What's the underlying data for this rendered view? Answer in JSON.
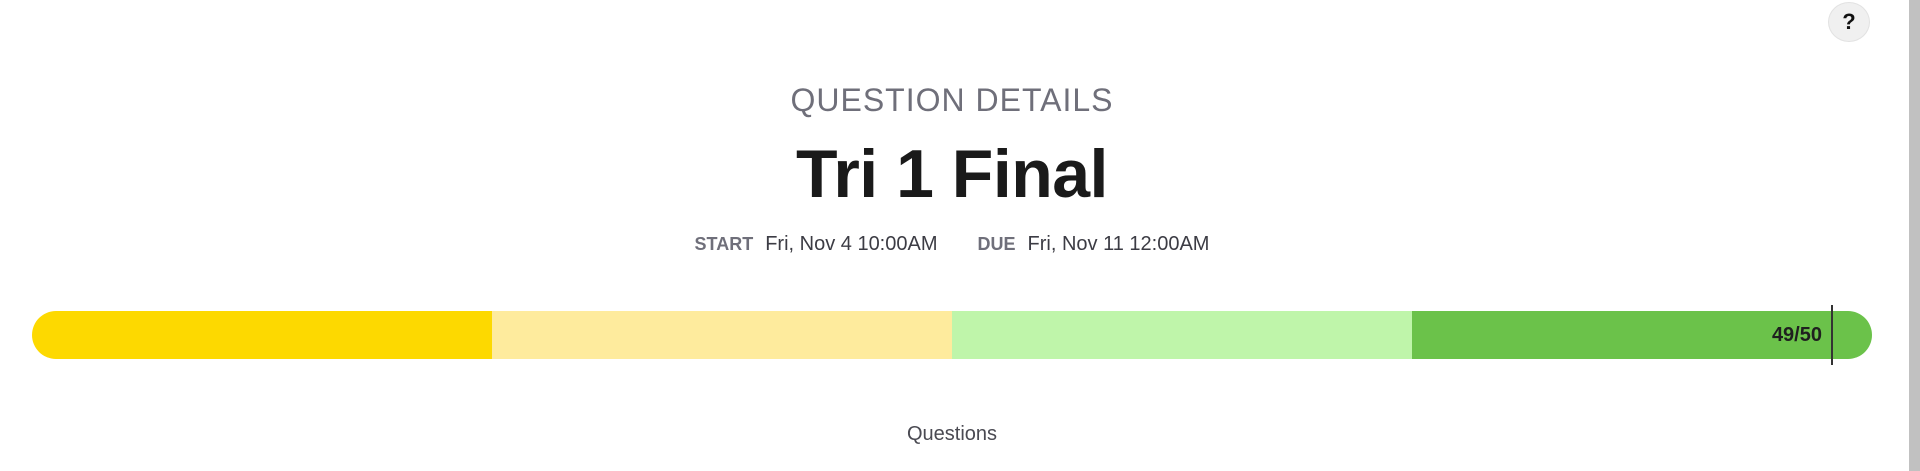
{
  "help": {
    "label": "?"
  },
  "header": {
    "subheading": "QUESTION DETAILS",
    "title": "Tri 1 Final"
  },
  "schedule": {
    "start_label": "START",
    "start_value": "Fri, Nov 4 10:00AM",
    "due_label": "DUE",
    "due_value": "Fri, Nov 11 12:00AM"
  },
  "progress": {
    "label": "49/50",
    "current": 49,
    "total": 50,
    "segment_colors": [
      "#fdd900",
      "#feeb9d",
      "#bff5aa",
      "#6bc24a"
    ]
  },
  "section": {
    "questions_label": "Questions"
  }
}
